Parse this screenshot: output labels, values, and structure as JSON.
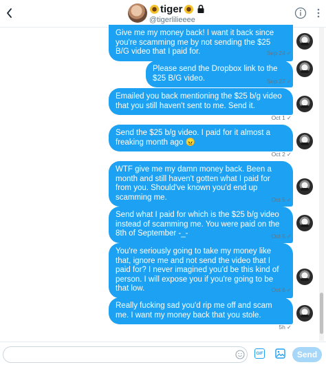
{
  "header": {
    "display_name": "tiger",
    "handle": "@tigerlilieeee",
    "icons": {
      "back": "back-arrow-icon",
      "info": "info-icon",
      "lock": "lock-icon",
      "emoji_decoration": "sunflower-icon"
    }
  },
  "messages": [
    {
      "text": "Give me my money back! I want it back since you're scamming me by not sending the $25 B/G video that I paid for.",
      "time": "Sep 24",
      "read_mark": "✓"
    },
    {
      "text": "Please send the Dropbox link to the $25 B/G video.",
      "time": "Sep 27",
      "read_mark": "✓"
    },
    {
      "text": "Emailed you back mentioning the $25 b/g video that you still haven't sent to me. Send it.",
      "time": "Oct 1",
      "read_mark": "✓"
    },
    {
      "text": "Send the $25 b/g video. I paid for it almost a freaking month ago 😠",
      "time": "Oct 2",
      "read_mark": "✓"
    },
    {
      "text": "WTF give me my damn money back. Been a month and still haven't gotten what I paid for from you. Should've known you'd end up scamming me.",
      "time": "Oct 5",
      "read_mark": "✓"
    },
    {
      "text": "Send what I paid for which is the $25 b/g video instead of scamming me. You were paid on the 8th of September -_-",
      "time": "Oct 5",
      "read_mark": "✓"
    },
    {
      "text": "You're seriously going to take my money like that, ignore me and not send the video that I paid for? I never imagined you'd be this kind of person. I will expose you if you're going to be that low.",
      "time": "Oct 6",
      "read_mark": "✓"
    },
    {
      "text": "Really fucking sad you'd rip me off and scam me. I want my money back that you stole.",
      "time": "5h",
      "read_mark": "✓"
    }
  ],
  "composer": {
    "placeholder": "",
    "gif_label": "GIF",
    "send_label": "Send"
  },
  "colors": {
    "bubble": "#1da1f2",
    "send_disabled": "#a6d7f8",
    "timestamp": "#657786"
  }
}
